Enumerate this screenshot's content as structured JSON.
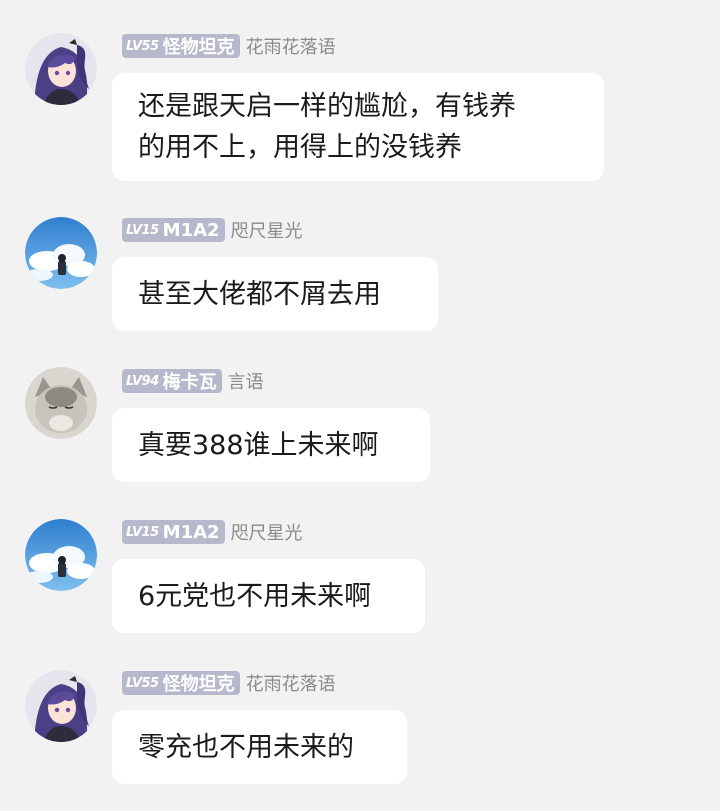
{
  "messages": [
    {
      "level": "LV55",
      "username": "怪物坦克",
      "title_tag": "花雨花落语",
      "avatar": "anime-girl-purple-hair-avatar",
      "text": "还是跟天启一样的尴尬，有钱养\n的用不上，用得上的没钱养"
    },
    {
      "level": "LV15",
      "username": "M1A2",
      "title_tag": "咫尺星光",
      "avatar": "sky-clouds-boy-avatar",
      "text": "甚至大佬都不屑去用"
    },
    {
      "level": "LV94",
      "username": "梅卡瓦",
      "title_tag": "言语",
      "avatar": "grey-cat-avatar",
      "text": "真要388谁上未来啊"
    },
    {
      "level": "LV15",
      "username": "M1A2",
      "title_tag": "咫尺星光",
      "avatar": "sky-clouds-boy-avatar",
      "text": "6元党也不用未来啊"
    },
    {
      "level": "LV55",
      "username": "怪物坦克",
      "title_tag": "花雨花落语",
      "avatar": "anime-girl-purple-hair-avatar",
      "text": "零充也不用未来的"
    }
  ],
  "colors": {
    "background": "#f2f2f2",
    "bubble": "#ffffff",
    "level_badge": "#b6b9cc",
    "tag_text": "#8a8a8a",
    "message_text": "#1b1b1b"
  }
}
